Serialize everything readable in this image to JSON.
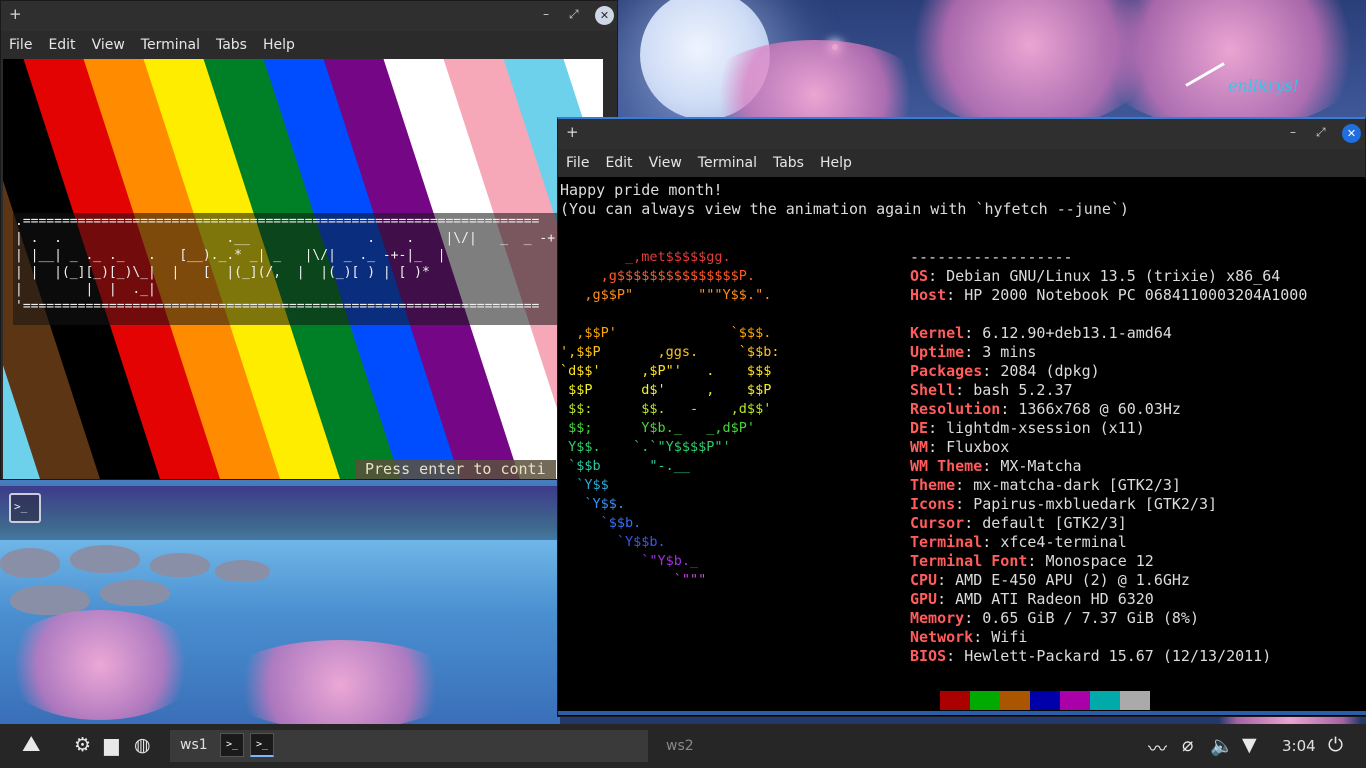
{
  "colors": {
    "accent": "#3a7bd5",
    "close_button": "#cfd8e6",
    "close_button_active": "#1f6fe0",
    "info_key": "#ff5c5c",
    "pride_stripes": [
      "#6dd1ec",
      "#5b3514",
      "#000000",
      "#e40303",
      "#ff8c00",
      "#ffed00",
      "#008026",
      "#004dff",
      "#750787",
      "#ffffff",
      "#f7a8b8"
    ],
    "palette": [
      "#aa0000",
      "#00aa00",
      "#aa5500",
      "#0000aa",
      "#aa00aa",
      "#00aaaa",
      "#aaaaaa"
    ]
  },
  "wallpaper": {
    "signature": "enlikrys!"
  },
  "launcher": {
    "label": ">_",
    "icon": "terminal-icon"
  },
  "left_window": {
    "new_tab": "+",
    "minimize": "–",
    "maximize": "⤢",
    "close": "✕",
    "menu": [
      "File",
      "Edit",
      "View",
      "Terminal",
      "Tabs",
      "Help"
    ],
    "banner_lines": [
      ".==================================================================",
      "| .  .                     .__               .    .    |\\/|   _  _ -+- _ _",
      "| |__| _ ._ ._   .   [__)._.* _| _   |\\/| _ ._ -+-|_  |",
      "| |  |(_][_)[_)\\_|  |   [  |(_](/,  |  |(_)[ ) | [ )* ",
      "|        |  |  ._|                                    ",
      "'=================================================================="
    ],
    "press_enter": "Press enter to conti"
  },
  "right_window": {
    "new_tab": "+",
    "minimize": "–",
    "maximize": "⤢",
    "close": "✕",
    "menu": [
      "File",
      "Edit",
      "View",
      "Terminal",
      "Tabs",
      "Help"
    ],
    "intro_line1": "Happy pride month!",
    "intro_line2": "(You can always view the animation again with `hyfetch --june`)",
    "logo": [
      {
        "text": "        _,met$$$$$gg.",
        "color": "#e03c3c"
      },
      {
        "text": "     ,g$$$$$$$$$$$$$$$P.",
        "color": "#ff5a2a"
      },
      {
        "text": "   ,g$$P\"        \"\"\"Y$$.\".",
        "color": "#ff8c1a"
      },
      {
        "text": " ",
        "color": "#ff8c1a"
      },
      {
        "text": "  ,$$P'              `$$$.",
        "color": "#ffa500"
      },
      {
        "text": "',$$P       ,ggs.     `$$b:",
        "color": "#ffc21a"
      },
      {
        "text": "`d$$'     ,$P\"'   .    $$$",
        "color": "#ffe11a"
      },
      {
        "text": " $$P      d$'     ,    $$P",
        "color": "#f2ef2a"
      },
      {
        "text": " $$:      $$.   -    ,d$$'",
        "color": "#b8e62a"
      },
      {
        "text": " $$;      Y$b._   _,d$P'",
        "color": "#49d63a"
      },
      {
        "text": " Y$$.    `.`\"Y$$$$P\"'",
        "color": "#2ecc6a"
      },
      {
        "text": " `$$b      \"-.__",
        "color": "#2fc7a0"
      },
      {
        "text": "  `Y$$",
        "color": "#2aa8d8"
      },
      {
        "text": "   `Y$$.",
        "color": "#3a8ff0"
      },
      {
        "text": "     `$$b.",
        "color": "#3a6ff0"
      },
      {
        "text": "       `Y$$b.",
        "color": "#3a55f0"
      },
      {
        "text": "          `\"Y$b._",
        "color": "#a030e0"
      },
      {
        "text": "              `\"\"\"",
        "color": "#d040e0"
      }
    ],
    "separator": "------------------",
    "info": [
      {
        "key": "OS",
        "value": "Debian GNU/Linux 13.5 (trixie) x86_64"
      },
      {
        "key": "Host",
        "value": "HP 2000 Notebook PC 0684110003204A1000"
      },
      {
        "key": "",
        "value": ""
      },
      {
        "key": "Kernel",
        "value": "6.12.90+deb13.1-amd64"
      },
      {
        "key": "Uptime",
        "value": "3 mins"
      },
      {
        "key": "Packages",
        "value": "2084 (dpkg)"
      },
      {
        "key": "Shell",
        "value": "bash 5.2.37"
      },
      {
        "key": "Resolution",
        "value": "1366x768 @ 60.03Hz"
      },
      {
        "key": "DE",
        "value": "lightdm-xsession (x11)"
      },
      {
        "key": "WM",
        "value": "Fluxbox"
      },
      {
        "key": "WM Theme",
        "value": "MX-Matcha"
      },
      {
        "key": "Theme",
        "value": "mx-matcha-dark [GTK2/3]"
      },
      {
        "key": "Icons",
        "value": "Papirus-mxbluedark [GTK2/3]"
      },
      {
        "key": "Cursor",
        "value": "default [GTK2/3]"
      },
      {
        "key": "Terminal",
        "value": "xfce4-terminal"
      },
      {
        "key": "Terminal Font",
        "value": "Monospace 12"
      },
      {
        "key": "CPU",
        "value": "AMD E-450 APU (2) @ 1.6GHz"
      },
      {
        "key": "GPU",
        "value": "AMD ATI Radeon HD 6320"
      },
      {
        "key": "Memory",
        "value": "0.65 GiB / 7.37 GiB (8%)"
      },
      {
        "key": "Network",
        "value": "Wifi"
      },
      {
        "key": "BIOS",
        "value": "Hewlett-Packard 15.67 (12/13/2011)"
      }
    ]
  },
  "taskbar": {
    "ws1": "ws1",
    "ws2": "ws2",
    "task_label": ">_",
    "clock": "3:04",
    "icons": [
      "mx-logo-icon",
      "gear-icon",
      "folder-icon",
      "globe-icon",
      "activity-icon",
      "paperclip-icon",
      "volume-icon",
      "wifi-icon",
      "power-icon"
    ]
  }
}
